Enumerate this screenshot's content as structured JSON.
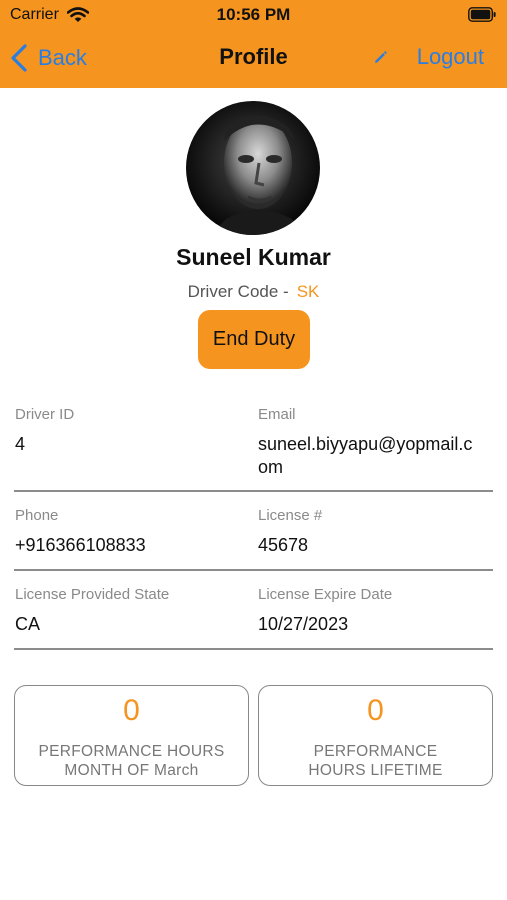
{
  "status_bar": {
    "carrier": "Carrier",
    "time": "10:56 PM"
  },
  "nav": {
    "back_label": "Back",
    "title": "Profile",
    "logout_label": "Logout"
  },
  "profile": {
    "name": "Suneel Kumar",
    "driver_code_label": "Driver Code -",
    "driver_code_value": "SK",
    "end_duty_label": "End Duty"
  },
  "details": {
    "driver_id_label": "Driver ID",
    "driver_id_value": "4",
    "email_label": "Email",
    "email_line1": "suneel.biyyapu@yopmail.c",
    "email_line2": "om",
    "phone_label": "Phone",
    "phone_value": "+916366108833",
    "license_label": "License #",
    "license_value": "45678",
    "license_state_label": "License Provided State",
    "license_state_value": "CA",
    "license_expire_label": "License Expire Date",
    "license_expire_value": "10/27/2023"
  },
  "stats": {
    "month_value": "0",
    "month_label_line1": "PERFORMANCE HOURS",
    "month_label_line2": "MONTH OF March",
    "lifetime_value": "0",
    "lifetime_label_line1": "PERFORMANCE",
    "lifetime_label_line2": "HOURS LIFETIME"
  },
  "colors": {
    "accent": "#f5951f",
    "link": "#2a7de1",
    "divider": "#8c8c8c"
  },
  "icons": [
    "wifi-icon",
    "battery-icon",
    "chevron-left-icon",
    "pencil-icon",
    "avatar-photo"
  ]
}
